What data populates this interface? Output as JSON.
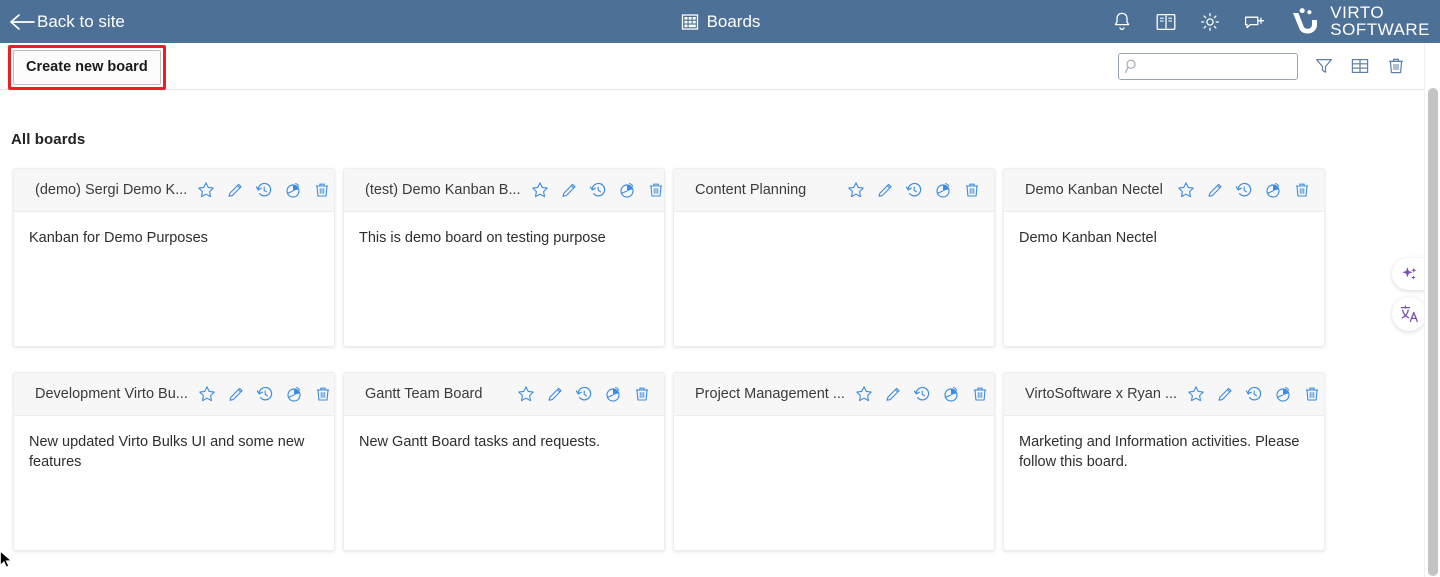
{
  "header": {
    "back_label": "Back to site",
    "back_icon": "arrow-left-icon",
    "title": "Boards",
    "title_icon": "boards-grid-icon",
    "bg_color": "#4d7097",
    "icons": [
      {
        "name": "notifications-icon",
        "label": "Notifications"
      },
      {
        "name": "documentation-icon",
        "label": "Documentation"
      },
      {
        "name": "settings-gear-icon",
        "label": "Settings"
      },
      {
        "name": "feedback-chat-icon",
        "label": "Feedback"
      }
    ],
    "brand": {
      "line1": "VIRTO",
      "line2": "SOFTWARE",
      "logo_icon": "virto-logo-icon"
    }
  },
  "toolbar": {
    "create_button": "Create new board",
    "highlight_color": "#ee1c25",
    "search": {
      "value": "",
      "placeholder": ""
    },
    "icons": [
      {
        "name": "filter-funnel-icon",
        "label": "Filter"
      },
      {
        "name": "table-view-icon",
        "label": "Table view"
      },
      {
        "name": "delete-trash-icon",
        "label": "Delete"
      }
    ]
  },
  "main": {
    "section_title": "All boards",
    "card_action_icons": [
      {
        "name": "favorite-star-icon",
        "label": "Favorite"
      },
      {
        "name": "edit-pencil-icon",
        "label": "Edit"
      },
      {
        "name": "history-clock-icon",
        "label": "History"
      },
      {
        "name": "chart-pie-icon",
        "label": "Charts"
      },
      {
        "name": "delete-trash-icon",
        "label": "Delete"
      }
    ],
    "boards": [
      {
        "title": "(demo) Sergi Demo K...",
        "description": "Kanban for Demo Purposes"
      },
      {
        "title": "(test) Demo Kanban B...",
        "description": "This is demo board on testing purpose"
      },
      {
        "title": "Content Planning",
        "description": ""
      },
      {
        "title": "Demo Kanban Nectel",
        "description": "Demo Kanban Nectel"
      },
      {
        "title": "Development Virto Bu...",
        "description": "New updated Virto Bulks UI and some new features"
      },
      {
        "title": "Gantt Team Board",
        "description": "New Gantt Board tasks and requests."
      },
      {
        "title": "Project Management ...",
        "description": ""
      },
      {
        "title": "VirtoSoftware x Ryan ...",
        "description": "Marketing and Information activities. Please follow this board."
      }
    ]
  },
  "floating": {
    "accent_color": "#7a4fb5",
    "buttons": [
      {
        "name": "ai-sparkles-icon",
        "label": "AI assistant"
      },
      {
        "name": "translate-icon",
        "label": "Translate"
      }
    ]
  },
  "scrollbar": {
    "name": "vertical-scrollbar",
    "thumb_color": "#c4c4c4"
  }
}
